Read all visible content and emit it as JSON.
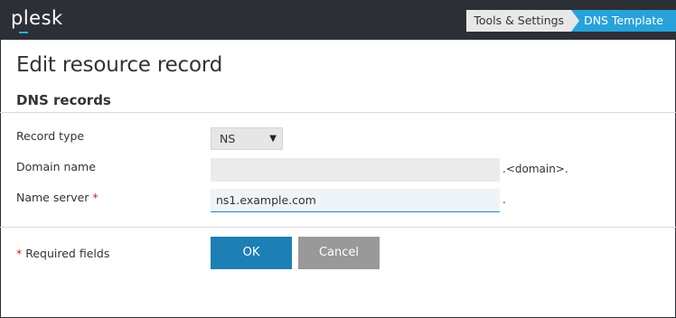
{
  "app": {
    "logo_text": "plesk"
  },
  "breadcrumbs": [
    {
      "label": "Tools & Settings"
    },
    {
      "label": "DNS Template"
    }
  ],
  "page": {
    "title": "Edit resource record",
    "section_title": "DNS records"
  },
  "form": {
    "record_type": {
      "label": "Record type",
      "value": "NS"
    },
    "domain_name": {
      "label": "Domain name",
      "value": "",
      "suffix": ".<domain>."
    },
    "name_server": {
      "label": "Name server",
      "required_marker": "*",
      "value": "ns1.example.com",
      "suffix": "."
    },
    "required_note": {
      "marker": "*",
      "text": "Required fields"
    }
  },
  "buttons": {
    "ok_label": "OK",
    "cancel_label": "Cancel"
  },
  "colors": {
    "topbar": "#2c3036",
    "accent": "#28a2d8",
    "ok_button": "#1d7fb3",
    "cancel_button": "#999999",
    "required": "#d02020"
  }
}
